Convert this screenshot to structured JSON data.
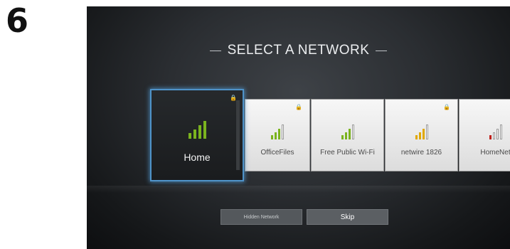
{
  "step_number": "6",
  "title": "SELECT A NETWORK",
  "networks": [
    {
      "name": "Home",
      "locked": true,
      "selected": true,
      "signal": 4,
      "signal_color": "#7bb31e"
    },
    {
      "name": "OfficeFiles",
      "locked": true,
      "selected": false,
      "signal": 3,
      "signal_color": "#7bb31e"
    },
    {
      "name": "Free Public Wi-Fi",
      "locked": false,
      "selected": false,
      "signal": 3,
      "signal_color": "#7bb31e"
    },
    {
      "name": "netwire 1826",
      "locked": true,
      "selected": false,
      "signal": 3,
      "signal_color": "#e0a800"
    },
    {
      "name": "HomeNet",
      "locked": false,
      "selected": false,
      "signal": 1,
      "signal_color": "#c0201b"
    }
  ],
  "lock_icon": "lock-icon",
  "signal_icon": "wifi-signal-icon",
  "buttons": {
    "hidden_network": "Hidden Network",
    "skip": "Skip"
  },
  "colors": {
    "focus_border": "#4f93c9",
    "empty_bar": "#ffffff"
  }
}
